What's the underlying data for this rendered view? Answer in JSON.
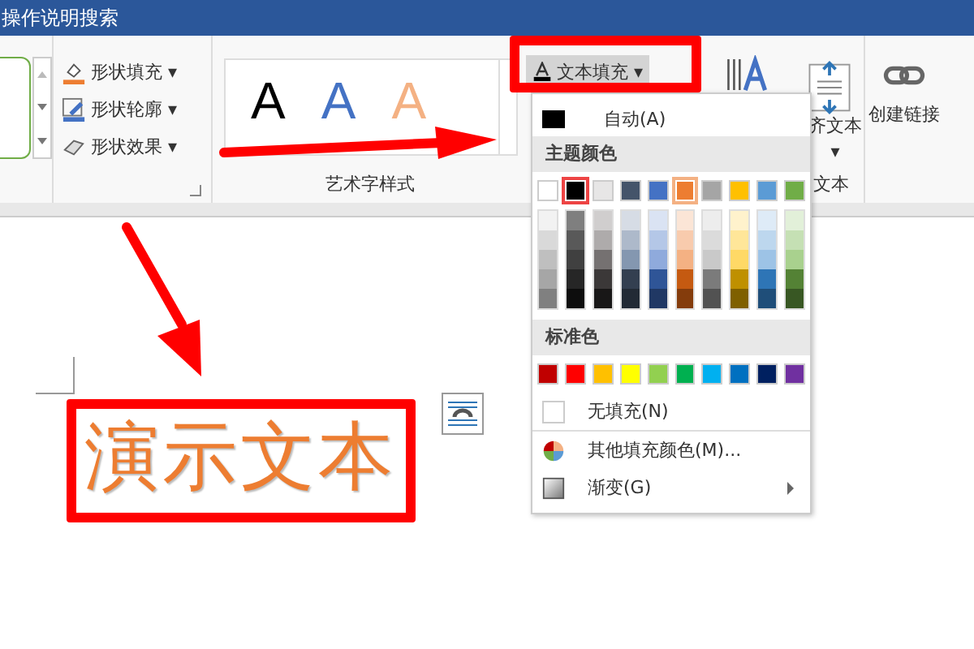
{
  "title_bar": {
    "search_hint": "操作说明搜索"
  },
  "shape_commands": [
    {
      "label": "形状填充",
      "caret": "▾",
      "kind": "fill"
    },
    {
      "label": "形状轮廓",
      "caret": "▾",
      "kind": "outline"
    },
    {
      "label": "形状效果",
      "caret": "▾",
      "kind": "effects"
    }
  ],
  "wordart_styles": [
    {
      "glyph": "A",
      "color": "#000000"
    },
    {
      "glyph": "A",
      "color": "#4472c4"
    },
    {
      "glyph": "A",
      "color": "#f4b183"
    }
  ],
  "wordart_group_label": "艺术字样式",
  "text_fill_button": {
    "label": "文本填充",
    "caret": "▾",
    "expanded": true
  },
  "align_text_button": {
    "label": "齐文本",
    "caret": "▾"
  },
  "text_group_label": "文本",
  "create_link_button": {
    "label": "创建链接"
  },
  "color_menu": {
    "automatic": "自动(A)",
    "theme_heading": "主题颜色",
    "theme_colors": [
      {
        "color": "#ffffff",
        "selected": false,
        "hovered": false,
        "shades": [
          {
            "color": "#f2f2f2"
          },
          {
            "color": "#d9d9d9"
          },
          {
            "color": "#bfbfbf"
          },
          {
            "color": "#a6a6a6"
          },
          {
            "color": "#808080"
          }
        ]
      },
      {
        "color": "#000000",
        "selected": true,
        "hovered": false,
        "shades": [
          {
            "color": "#7f7f7f"
          },
          {
            "color": "#595959"
          },
          {
            "color": "#404040"
          },
          {
            "color": "#262626"
          },
          {
            "color": "#0d0d0d"
          }
        ]
      },
      {
        "color": "#e7e6e6",
        "selected": false,
        "hovered": false,
        "shades": [
          {
            "color": "#d0cece"
          },
          {
            "color": "#aeabab"
          },
          {
            "color": "#757171"
          },
          {
            "color": "#3b3838"
          },
          {
            "color": "#181717"
          }
        ]
      },
      {
        "color": "#44546a",
        "selected": false,
        "hovered": false,
        "shades": [
          {
            "color": "#d6dce5"
          },
          {
            "color": "#adb9ca"
          },
          {
            "color": "#8497b0"
          },
          {
            "color": "#333f50"
          },
          {
            "color": "#222a35"
          }
        ]
      },
      {
        "color": "#4472c4",
        "selected": false,
        "hovered": false,
        "shades": [
          {
            "color": "#dae3f3"
          },
          {
            "color": "#b4c7e7"
          },
          {
            "color": "#8faadc"
          },
          {
            "color": "#2f5597"
          },
          {
            "color": "#203864"
          }
        ]
      },
      {
        "color": "#ed7d31",
        "selected": false,
        "hovered": true,
        "shades": [
          {
            "color": "#fbe5d6"
          },
          {
            "color": "#f8cbad"
          },
          {
            "color": "#f4b183"
          },
          {
            "color": "#c55a11"
          },
          {
            "color": "#843c0c"
          }
        ]
      },
      {
        "color": "#a5a5a5",
        "selected": false,
        "hovered": false,
        "shades": [
          {
            "color": "#ededed"
          },
          {
            "color": "#dbdbdb"
          },
          {
            "color": "#c9c9c9"
          },
          {
            "color": "#7b7b7b"
          },
          {
            "color": "#525252"
          }
        ]
      },
      {
        "color": "#ffc000",
        "selected": false,
        "hovered": false,
        "shades": [
          {
            "color": "#fff2cc"
          },
          {
            "color": "#ffe699"
          },
          {
            "color": "#ffd966"
          },
          {
            "color": "#bf9000"
          },
          {
            "color": "#7f6000"
          }
        ]
      },
      {
        "color": "#5b9bd5",
        "selected": false,
        "hovered": false,
        "shades": [
          {
            "color": "#deebf7"
          },
          {
            "color": "#bdd7ee"
          },
          {
            "color": "#9dc3e6"
          },
          {
            "color": "#2e75b6"
          },
          {
            "color": "#1f4e79"
          }
        ]
      },
      {
        "color": "#70ad47",
        "selected": false,
        "hovered": false,
        "shades": [
          {
            "color": "#e2f0d9"
          },
          {
            "color": "#c5e0b4"
          },
          {
            "color": "#a9d18e"
          },
          {
            "color": "#548235"
          },
          {
            "color": "#385723"
          }
        ]
      }
    ],
    "standard_heading": "标准色",
    "standard_colors": [
      {
        "color": "#c00000"
      },
      {
        "color": "#ff0000"
      },
      {
        "color": "#ffc000"
      },
      {
        "color": "#ffff00"
      },
      {
        "color": "#92d050"
      },
      {
        "color": "#00b050"
      },
      {
        "color": "#00b0f0"
      },
      {
        "color": "#0070c0"
      },
      {
        "color": "#002060"
      },
      {
        "color": "#7030a0"
      }
    ],
    "items": [
      {
        "kind": "no-fill",
        "label": "无填充(N)",
        "submenu": false
      },
      {
        "kind": "more-colors",
        "label": "其他填充颜色(M)...",
        "submenu": false
      },
      {
        "kind": "gradient",
        "label": "渐变(G)",
        "submenu": true
      }
    ]
  },
  "document": {
    "demo_text": "演示文本"
  }
}
